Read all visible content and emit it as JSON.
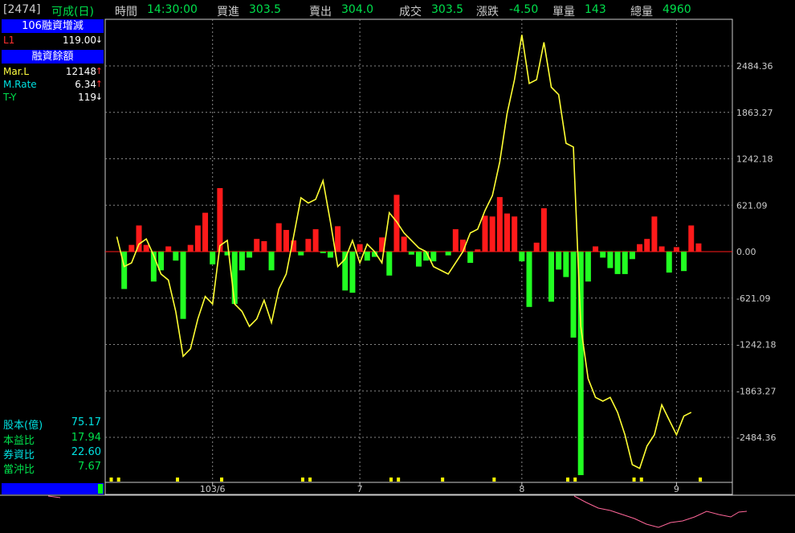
{
  "header": {
    "code": "[2474]",
    "name": "可成(日)",
    "time_label": "時間",
    "time_value": "14:30:00",
    "buy_label": "買進",
    "buy_value": "303.5",
    "sell_label": "賣出",
    "sell_value": "304.0",
    "deal_label": "成交",
    "deal_value": "303.5",
    "change_label": "漲跌",
    "change_value": "-4.50",
    "vol_label": "單量",
    "vol_value": "143",
    "total_label": "總量",
    "total_value": "4960"
  },
  "sidebar": {
    "head1": "106融資增減",
    "l1_label": "L1",
    "l1_value": "119.00",
    "head2": "融資餘額",
    "rows": [
      {
        "label": "Mar.L",
        "value": "12148",
        "arrow": "↑"
      },
      {
        "label": "M.Rate",
        "value": "6.34",
        "arrow": "↑"
      },
      {
        "label": "T-Y",
        "value": "119",
        "arrow": "↓"
      }
    ],
    "stats": [
      {
        "label": "股本(億)",
        "value": "75.17"
      },
      {
        "label": "本益比",
        "value": "17.94"
      },
      {
        "label": "券資比",
        "value": "22.60"
      },
      {
        "label": "當沖比",
        "value": "7.67"
      }
    ]
  },
  "colors": {
    "up": "#ff1a1a",
    "down": "#22ff22",
    "line": "#ffff33",
    "grid": "#888888",
    "axis_text": "#cccccc",
    "marker": "#ffff00",
    "lower_line": "#ff6699"
  },
  "chart_data": {
    "type": "bar",
    "ylim": [
      -2800,
      2850
    ],
    "y_ticks": [
      "2484.36",
      "1863.27",
      "1242.18",
      "621.09",
      "0.00",
      "-621.09",
      "-1242.18",
      "-1863.27",
      "-2484.36"
    ],
    "y_tick_values": [
      2484.36,
      1863.27,
      1242.18,
      621.09,
      0.0,
      -621.09,
      -1242.18,
      -1863.27,
      -2484.36
    ],
    "x_tick_labels": [
      {
        "label": "103/6",
        "index": 13
      },
      {
        "label": "7",
        "index": 33
      },
      {
        "label": "8",
        "index": 55
      },
      {
        "label": "9",
        "index": 76
      }
    ],
    "series": [
      {
        "type": "bar",
        "values": [
          0,
          -500,
          90,
          350,
          90,
          -400,
          -250,
          70,
          -120,
          -900,
          90,
          350,
          520,
          -170,
          850,
          -50,
          -700,
          -250,
          -80,
          170,
          140,
          -250,
          380,
          290,
          150,
          -50,
          170,
          300,
          -20,
          -80,
          340,
          -520,
          -550,
          100,
          -120,
          -70,
          190,
          -320,
          760,
          200,
          -40,
          -200,
          -120,
          -130,
          0,
          -50,
          300,
          160,
          -150,
          30,
          480,
          470,
          730,
          510,
          470,
          -130,
          -740,
          120,
          580,
          -670,
          -240,
          -340,
          -1150,
          -2990,
          -400,
          70,
          -80,
          -220,
          -300,
          -300,
          -100,
          100,
          170,
          470,
          70,
          -280,
          60,
          -260,
          350,
          110
        ],
        "bar_x_step": 1
      },
      {
        "type": "line",
        "values": [
          200,
          -200,
          -150,
          100,
          170,
          -50,
          -300,
          -380,
          -800,
          -1400,
          -1300,
          -900,
          -600,
          -700,
          80,
          150,
          -700,
          -800,
          -1000,
          -900,
          -650,
          -950,
          -500,
          -300,
          200,
          720,
          650,
          700,
          950,
          400,
          -200,
          -100,
          150,
          -150,
          100,
          0,
          -150,
          520,
          400,
          250,
          150,
          50,
          0,
          -200,
          -250,
          -300,
          -150,
          0,
          250,
          300,
          550,
          750,
          1200,
          1850,
          2300,
          2900,
          2250,
          2300,
          2800,
          2200,
          2100,
          1450,
          1400,
          -1000,
          -1700,
          -1950,
          -2000,
          -1950,
          -2150,
          -2450,
          -2850,
          -2900,
          -2600,
          -2450,
          -2050,
          -2250,
          -2450,
          -2200,
          -2150
        ],
        "line_start_index": 1
      }
    ]
  }
}
